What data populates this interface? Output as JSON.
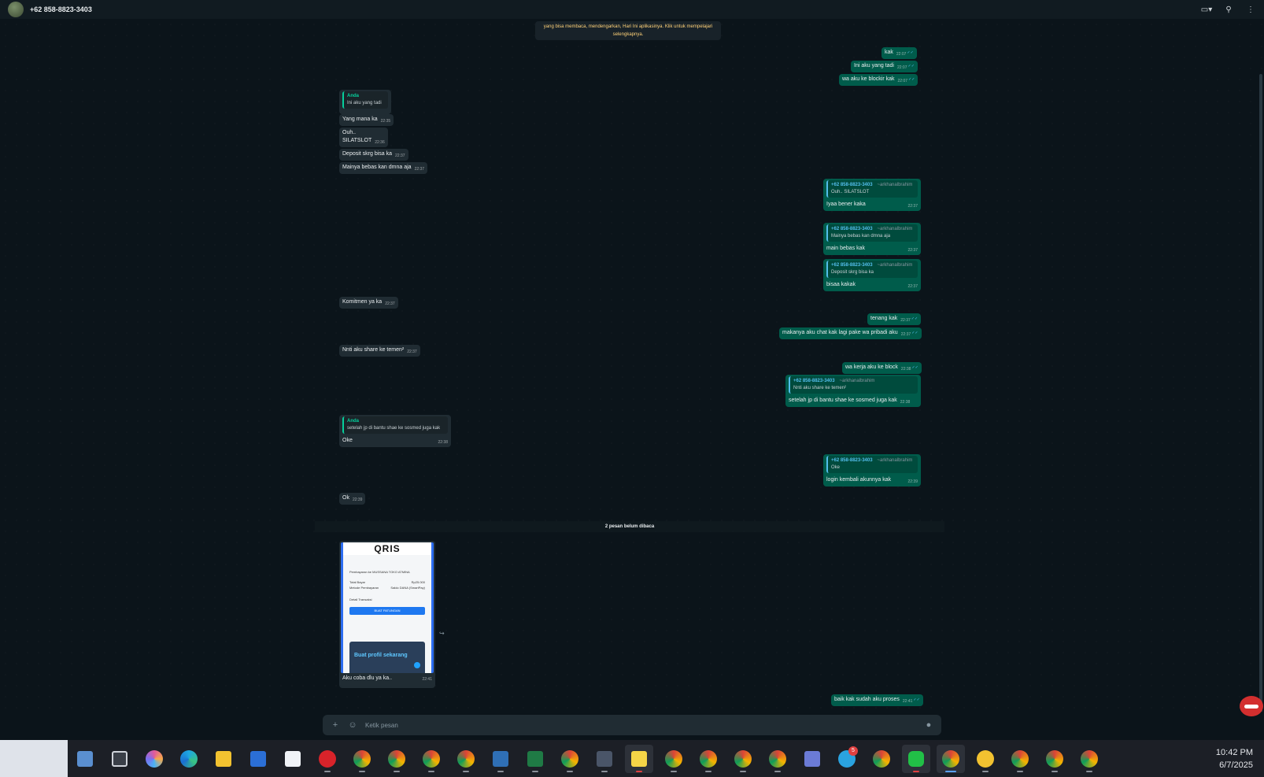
{
  "header": {
    "contact": "+62 858-8823-3403"
  },
  "system_note": {
    "text": "yang bisa membaca, mendengarkan, Hari Ini aplikasinya. Klik untuk mempelajari selengkapnya."
  },
  "messages": {
    "m1": {
      "text": "kak",
      "time": "22:07"
    },
    "m2": {
      "text": "Ini aku yang tadi",
      "time": "22:07"
    },
    "m3": {
      "text": "wa aku ke blockir kak",
      "time": "22:07"
    },
    "m4": {
      "quote_author": "Anda",
      "quote_text": "Ini aku yang tadi"
    },
    "m5": {
      "text": "Yang mana ka",
      "time": "22:35"
    },
    "m6": {
      "text1": "Ouh..",
      "text2": "SILATSLOT",
      "time": "22:36"
    },
    "m7": {
      "text": "Deposit skrg bisa ka",
      "time": "22:37"
    },
    "m8": {
      "text": "Mainya bebas kan dmna aja",
      "time": "22:37"
    },
    "m9": {
      "quote_author": "+62 858-8823-3403",
      "quote_sub": "~arkhanalbrahim",
      "quote_text": "Ouh.. SILATSLOT",
      "text": "Iyaa bener kaka",
      "time": "22:37"
    },
    "m10": {
      "quote_author": "+62 858-8823-3403",
      "quote_sub": "~arkhanalbrahim",
      "quote_text": "Mainya bebas kan dmna aja",
      "text": "main bebas kak",
      "time": "22:37"
    },
    "m11": {
      "quote_author": "+62 858-8823-3403",
      "quote_sub": "~arkhanalbrahim",
      "quote_text": "Deposit skrg bisa ka",
      "text": "bisaa kakak",
      "time": "22:37"
    },
    "m12": {
      "text": "Komitmen ya ka",
      "time": "22:37"
    },
    "m13": {
      "text": "tenang kak",
      "time": "22:37"
    },
    "m14": {
      "text": "makanya aku chat kak lagi pake wa pribadi aku",
      "time": "22:37"
    },
    "m15": {
      "text": "Nnti aku share ke temen²",
      "time": "22:37"
    },
    "m16": {
      "text": "wa kerja aku ke block",
      "time": "22:38"
    },
    "m17": {
      "quote_author": "+62 858-8823-3403",
      "quote_sub": "~arkhanalbrahim",
      "quote_text": "Nnti aku share ke temen²",
      "text": "setelah jp di bantu shae ke sosmed juga kak",
      "time": "22:38"
    },
    "m18": {
      "quote_author": "Anda",
      "quote_text": "setelah jp di bantu shae ke sosmed juga kak",
      "text": "Oke",
      "time": "22:38"
    },
    "m19": {
      "quote_author": "+62 858-8823-3403",
      "quote_sub": "~arkhanalbrahim",
      "quote_text": "Oke",
      "text": "login kembali akunnya kak",
      "time": "22:39"
    },
    "m20": {
      "text": "Ok",
      "time": "22:39"
    },
    "unread_divider": "2 pesan belum dibaca",
    "media": {
      "logo": "QRIS",
      "title_row": "Pembayaran ke MUSSANA TOKO ATMINA",
      "total_label": "Total Bayar",
      "total_value": "Rp25.000",
      "method_label": "Metode Pembayaran",
      "method_value": "Saldo DANA (SmartPay)",
      "detail_label": "Detail Transaksi",
      "button": "BUAT PATUNGAN",
      "promo": "Buat profil sekarang",
      "caption": "Aku coba dlu ya ka..",
      "time": "22:41"
    },
    "m21": {
      "text": "baik kak sudah aku proses",
      "time": "22:41"
    }
  },
  "composer": {
    "placeholder": "Ketik pesan"
  },
  "taskbar": {
    "telegram_badge": "5",
    "time": "10:42 PM",
    "date": "6/7/2025"
  },
  "colors": {
    "outgoing": "#005c4b",
    "incoming": "#202c33",
    "accent": "#06cf9c"
  }
}
